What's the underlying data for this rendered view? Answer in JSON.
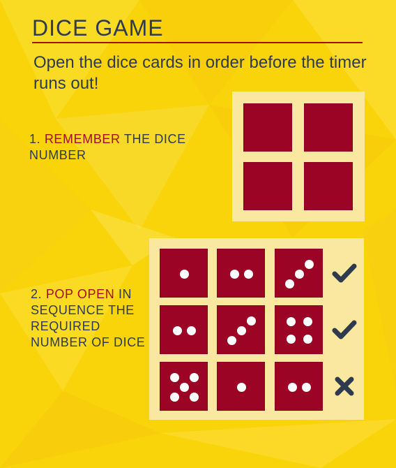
{
  "header": {
    "title": "DICE GAME",
    "subtitle": "Open the dice cards in order before the timer runs out!"
  },
  "step1": {
    "number": "1.",
    "highlight": "REMEMBER",
    "rest": "THE DICE NUMBER"
  },
  "step2": {
    "number": "2.",
    "highlight": "POP OPEN",
    "rest": "IN SEQUENCE THE REQUIRED NUMBER OF DICE"
  },
  "memory_grid": {
    "rows": 2,
    "cols": 2,
    "state": "face-down"
  },
  "sequence_grid": {
    "rows": [
      {
        "dice": [
          1,
          2,
          3
        ],
        "result": "correct"
      },
      {
        "dice": [
          2,
          3,
          4
        ],
        "result": "correct"
      },
      {
        "dice": [
          5,
          1,
          2
        ],
        "result": "wrong"
      }
    ]
  },
  "icons": {
    "correct": "check-icon",
    "wrong": "cross-icon"
  },
  "colors": {
    "background": "#f9d40a",
    "panel": "#fbe8a0",
    "card": "#9b0424",
    "pip": "#ffffff",
    "text": "#2e3a4d",
    "highlight": "#a20f1a",
    "mark": "#2e3a4d"
  }
}
